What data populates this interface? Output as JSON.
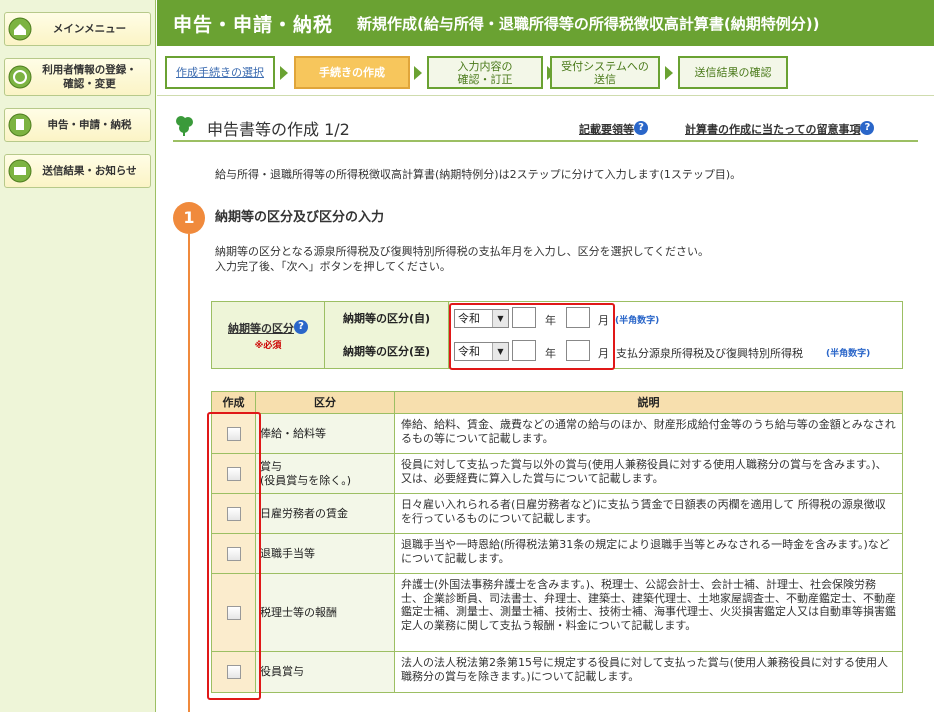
{
  "sidebar": {
    "items": [
      {
        "label": "メインメニュー",
        "icon": "home-icon"
      },
      {
        "label": "利用者情報の登録・\n確認・変更",
        "icon": "user-info-icon"
      },
      {
        "label": "申告・申請・納税",
        "icon": "document-icon"
      },
      {
        "label": "送信結果・お知らせ",
        "icon": "mail-icon"
      }
    ]
  },
  "header": {
    "main": "申告・申請・納税",
    "sub": "新規作成(給与所得・退職所得等の所得税徴収高計算書(納期特例分))"
  },
  "steps": [
    {
      "label": "作成手続きの選択",
      "state": "done"
    },
    {
      "label": "手続きの作成",
      "state": "current"
    },
    {
      "label": "入力内容の\n確認・訂正",
      "state": "todo"
    },
    {
      "label": "受付システムへの\n送信",
      "state": "todo"
    },
    {
      "label": "送信結果の確認",
      "state": "todo"
    }
  ],
  "page": {
    "title": "申告書等の作成 1/2",
    "link1": "記載要領等",
    "link2": "計算書の作成に当たっての留意事項",
    "intro": "給与所得・退職所得等の所得税徴収高計算書(納期特例分)は2ステップに分けて入力します(1ステップ目)。",
    "step_number": "1",
    "step_title": "納期等の区分及び区分の入力",
    "desc1": "納期等の区分となる源泉所得税及び復興特別所得税の支払年月を入力し、区分を選択してください。",
    "desc2": "入力完了後、「次へ」ボタンを押してください。"
  },
  "period": {
    "label": "納期等の区分",
    "required": "※必須",
    "from_label": "納期等の区分(自)",
    "to_label": "納期等の区分(至)",
    "era": "令和",
    "year_unit": "年",
    "month_unit": "月",
    "hint": "(半角数字)",
    "to_note": "支払分源泉所得税及び復興特別所得税"
  },
  "table": {
    "headers": [
      "作成",
      "区分",
      "説明"
    ],
    "rows": [
      {
        "kubun": "俸給・給料等",
        "desc": "俸給、給料、賃金、歳費などの通常の給与のほか、財産形成給付金等のうち給与等の金額とみなされるもの等について記載します。"
      },
      {
        "kubun": "賞与\n(役員賞与を除く。)",
        "desc": "役員に対して支払った賞与以外の賞与(使用人兼務役員に対する使用人職務分の賞与を含みます。)、又は、必要経費に算入した賞与について記載します。"
      },
      {
        "kubun": "日雇労務者の賃金",
        "desc": "日々雇い入れられる者(日雇労務者など)に支払う賃金で日額表の丙欄を適用して 所得税の源泉徴収を行っているものについて記載します。"
      },
      {
        "kubun": "退職手当等",
        "desc": "退職手当や一時恩給(所得税法第31条の規定により退職手当等とみなされる一時金を含みます。)などについて記載します。"
      },
      {
        "kubun": "税理士等の報酬",
        "desc": "弁護士(外国法事務弁護士を含みます。)、税理士、公認会計士、会計士補、計理士、社会保険労務士、企業診断員、司法書士、弁理士、建築士、建築代理士、土地家屋調査士、不動産鑑定士、不動産鑑定士補、測量士、測量士補、技術士、技術士補、海事代理士、火災損害鑑定人又は自動車等損害鑑定人の業務に関して支払う報酬・料金について記載します。"
      },
      {
        "kubun": "役員賞与",
        "desc": "法人の法人税法第2条第15号に規定する役員に対して支払った賞与(使用人兼務役員に対する使用人職務分の賞与を除きます。)について記載します。"
      }
    ]
  }
}
